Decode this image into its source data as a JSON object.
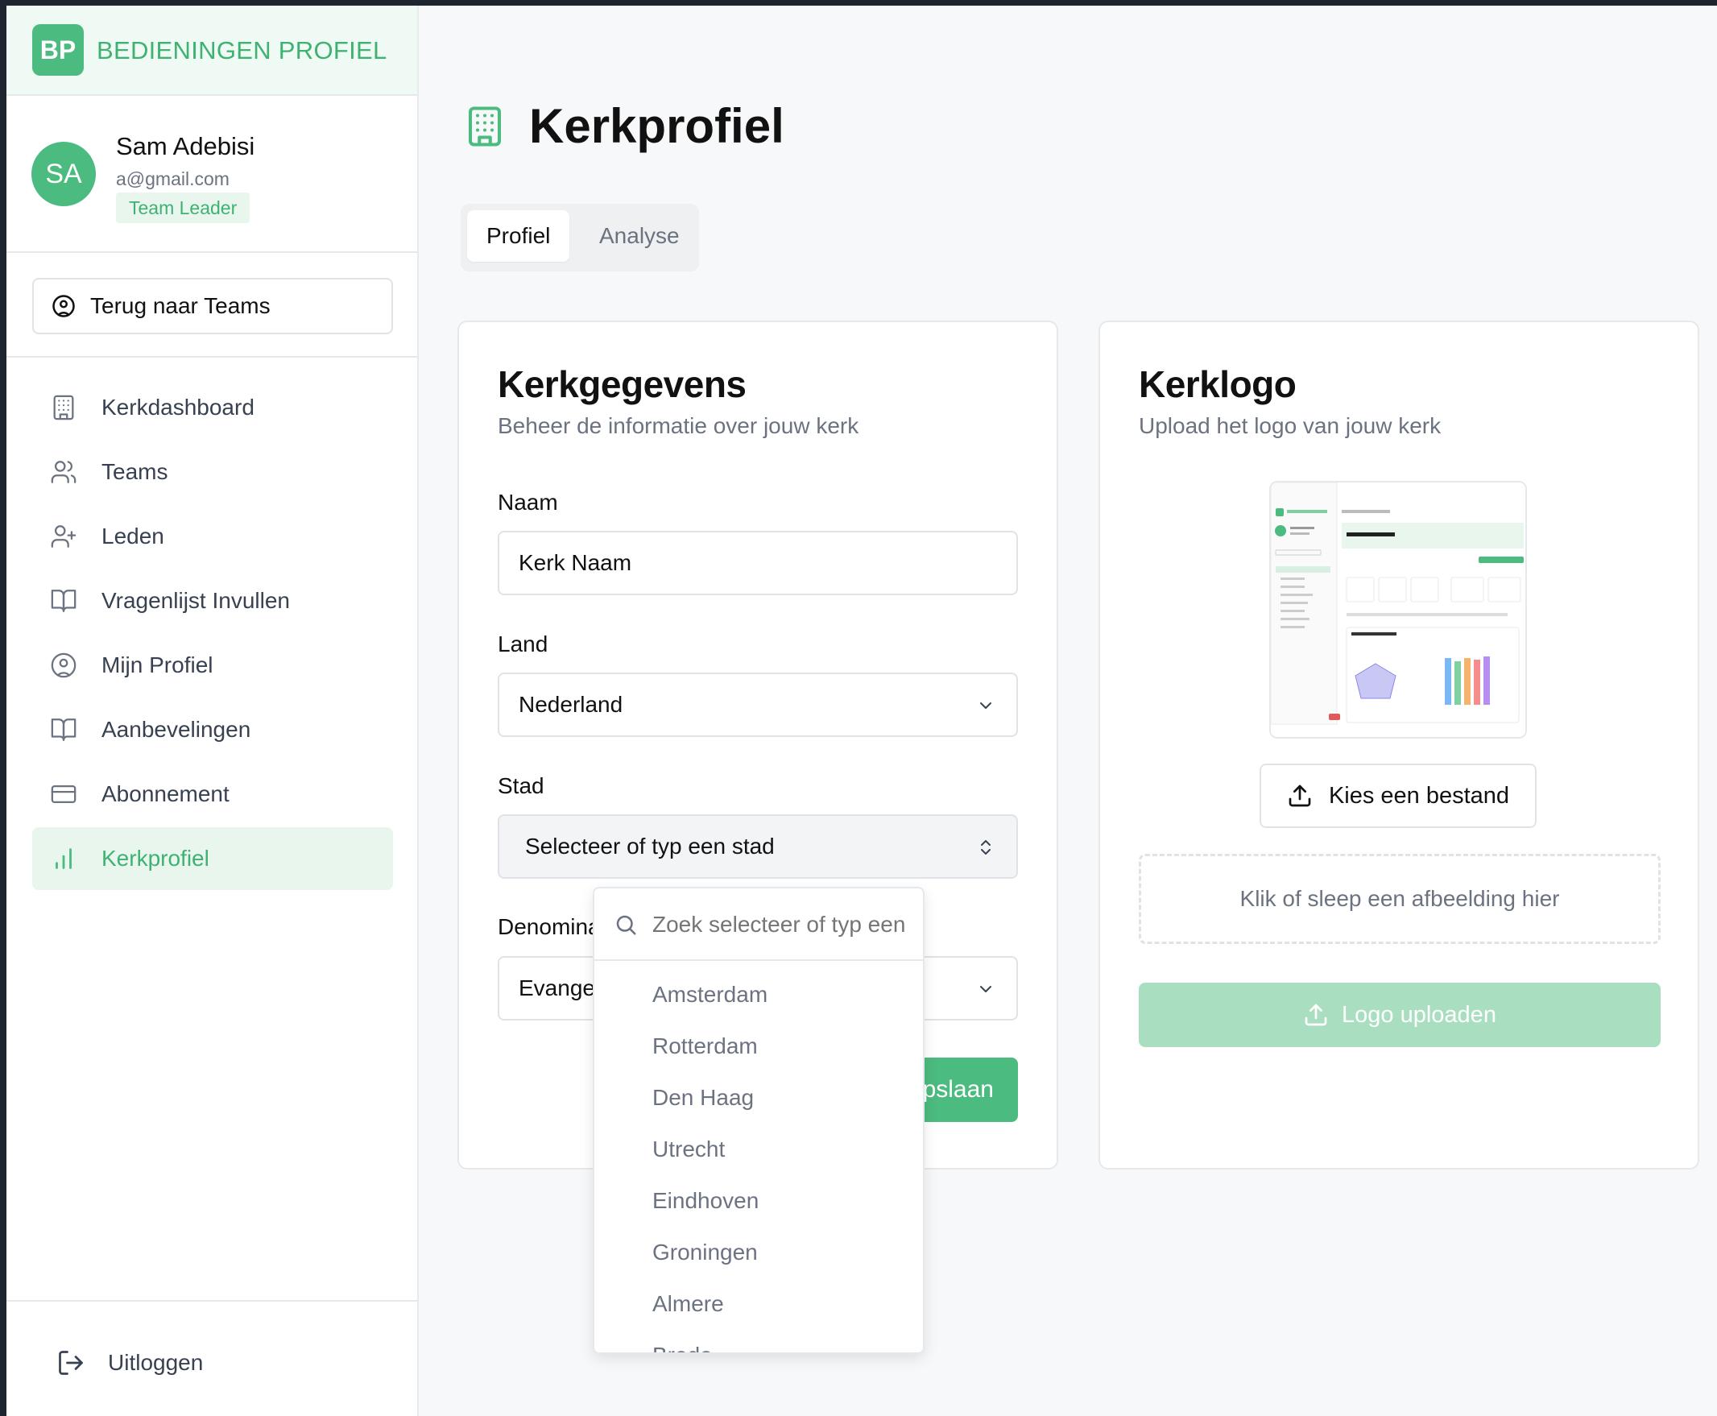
{
  "brand": {
    "initials": "BP",
    "name": "BEDIENINGEN PROFIEL"
  },
  "user": {
    "initials": "SA",
    "name": "Sam Adebisi",
    "email": "a@gmail.com",
    "role": "Team Leader"
  },
  "sidebar": {
    "back_label": "Terug naar Teams",
    "items": [
      {
        "label": "Kerkdashboard",
        "icon": "building-icon"
      },
      {
        "label": "Teams",
        "icon": "users-icon"
      },
      {
        "label": "Leden",
        "icon": "user-plus-icon"
      },
      {
        "label": "Vragenlijst Invullen",
        "icon": "book-open-icon"
      },
      {
        "label": "Mijn Profiel",
        "icon": "user-circle-icon"
      },
      {
        "label": "Aanbevelingen",
        "icon": "book-open-icon"
      },
      {
        "label": "Abonnement",
        "icon": "credit-card-icon"
      },
      {
        "label": "Kerkprofiel",
        "icon": "bar-chart-icon",
        "active": true
      }
    ],
    "logout_label": "Uitloggen"
  },
  "page": {
    "title": "Kerkprofiel",
    "tabs": [
      {
        "label": "Profiel",
        "active": true
      },
      {
        "label": "Analyse"
      }
    ]
  },
  "details_card": {
    "title": "Kerkgegevens",
    "subtitle": "Beheer de informatie over jouw kerk",
    "name_label": "Naam",
    "name_value": "Kerk Naam",
    "country_label": "Land",
    "country_value": "Nederland",
    "city_label": "Stad",
    "city_placeholder": "Selecteer of typ een stad",
    "denomination_label": "Denominatie",
    "denomination_value": "Evangelisch",
    "save_label": "Opslaan"
  },
  "logo_card": {
    "title": "Kerklogo",
    "subtitle": "Upload het logo van jouw kerk",
    "choose_label": "Kies een bestand",
    "dropzone_label": "Klik of sleep een afbeelding hier",
    "upload_label": "Logo uploaden"
  },
  "city_dropdown": {
    "search_placeholder": "Zoek selecteer of typ een stad",
    "options": [
      "Amsterdam",
      "Rotterdam",
      "Den Haag",
      "Utrecht",
      "Eindhoven",
      "Groningen",
      "Almere",
      "Breda"
    ]
  },
  "colors": {
    "accent": "#4cbb7f",
    "accent_light": "#e8f6ee",
    "muted": "#6b7280"
  }
}
